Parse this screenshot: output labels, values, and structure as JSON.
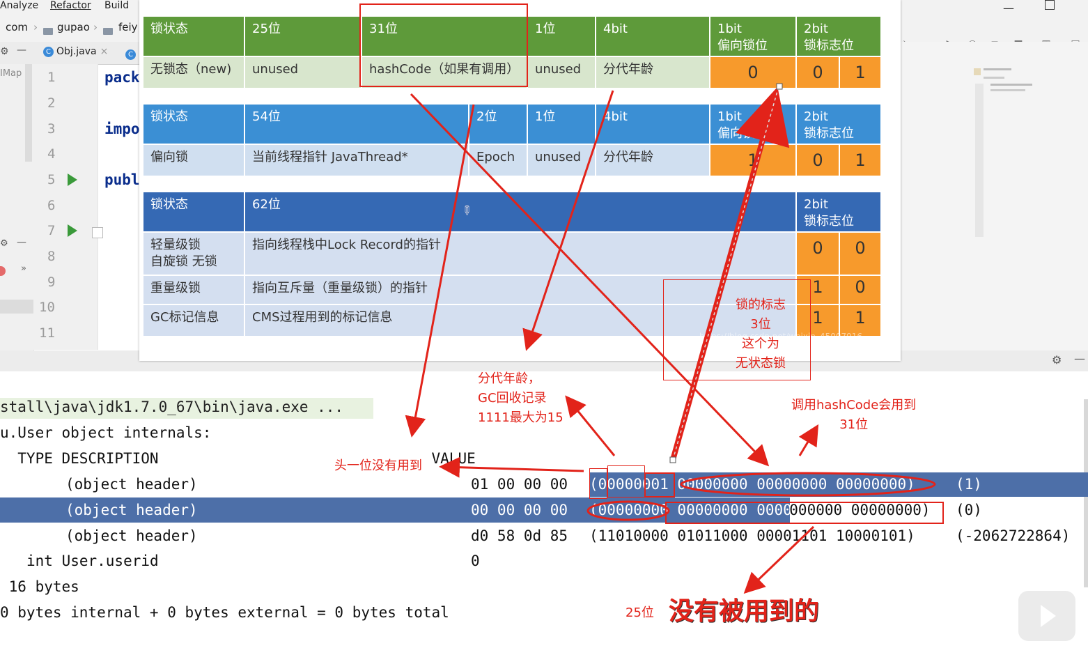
{
  "ide": {
    "menu": [
      "Analyze",
      "Refactor",
      "Build"
    ],
    "breadcrumb": [
      "com",
      "gupao",
      "feiy"
    ],
    "tab_label": "Obj.java",
    "left_strip_label": "IMap",
    "line_numbers": [
      "1",
      "2",
      "3",
      "4",
      "5",
      "6",
      "7",
      "8",
      "9",
      "10",
      "11"
    ],
    "code_lines": [
      "pack",
      "impo",
      "publ"
    ]
  },
  "slide": {
    "row1_headers": [
      "锁状态",
      "25位",
      "31位",
      "1位",
      "4bit",
      "1bit\n偏向锁位",
      "2bit\n锁标志位"
    ],
    "row1_values": [
      "无锁态（new)",
      "unused",
      "hashCode（如果有调用）",
      "unused",
      "分代年龄",
      "0",
      "0",
      "1"
    ],
    "row2_headers": [
      "锁状态",
      "54位",
      "2位",
      "1位",
      "4bit",
      "1bit\n偏向锁位",
      "2bit\n锁标志位"
    ],
    "row2_values": [
      "偏向锁",
      "当前线程指针 JavaThread*",
      "Epoch",
      "unused",
      "分代年龄",
      "1",
      "0",
      "1"
    ],
    "row3_headers": [
      "锁状态",
      "62位",
      "2bit\n锁标志位"
    ],
    "row3_rows": [
      {
        "state": "轻量级锁\n自旋锁 无锁",
        "desc": "指向线程栈中Lock Record的指针",
        "b1": "0",
        "b2": "0"
      },
      {
        "state": "重量级锁",
        "desc": "指向互斥量（重量级锁）的指针",
        "b1": "1",
        "b2": "0"
      },
      {
        "state": "GC标记信息",
        "desc": "CMS过程用到的标记信息",
        "b1": "1",
        "b2": "1"
      }
    ],
    "watermark": "https://blog.csdn.net/weixin_45007916"
  },
  "console": {
    "path": "stall\\java\\jdk1.7.0_67\\bin\\java.exe ...",
    "title": "u.User object internals:",
    "header": "  TYPE DESCRIPTION                               VALUE",
    "rows": [
      {
        "desc": "(object header)",
        "hex": "01 00 00 00",
        "bin": "(00000001 00000000 00000000 00000000)",
        "dec": "(1)"
      },
      {
        "desc": "(object header)",
        "hex": "00 00 00 00",
        "bin": "(00000000 00000000 00000000 00000000)",
        "dec": "(0)"
      },
      {
        "desc": "(object header)",
        "hex": "d0 58 0d 85",
        "bin": "(11010000 01011000 00001101 10000101)",
        "dec": "(-2062722864)"
      }
    ],
    "field_line": "int User.userid",
    "field_value": "0",
    "size_line": " 16 bytes",
    "loss_line": "0 bytes internal + 0 bytes external = 0 bytes total"
  },
  "annotations": {
    "lock_flag": "锁的标志\n3位\n这个为\n无状态锁",
    "gen_age": "分代年龄，\nGC回收记录\n1111最大为15",
    "hashcode": "调用hashCode会用到\n31位",
    "first_bit": "头一位没有用到",
    "unused_25_prefix": "25位",
    "unused_25": "没有被用到的"
  },
  "colors": {
    "annotation_red": "#e2231a",
    "green_header": "#5e9a3a",
    "blue_header": "#3b8fd4",
    "dark_blue_header": "#3569b4",
    "orange_bits": "#f79a2c",
    "selection": "#4d6fa8"
  }
}
